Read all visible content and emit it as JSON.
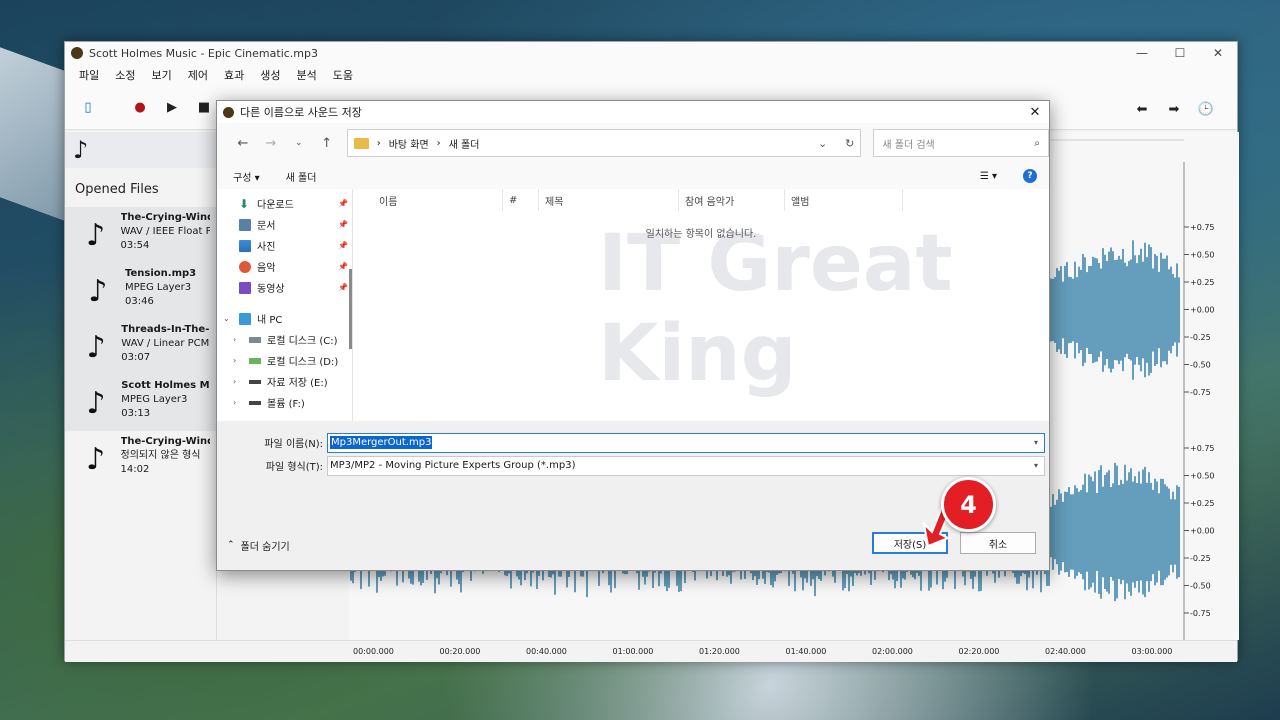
{
  "app": {
    "title": "Scott Holmes Music - Epic Cinematic.mp3",
    "menu": [
      "파일",
      "소정",
      "보기",
      "제어",
      "효과",
      "생성",
      "분석",
      "도움"
    ],
    "opened_files_title": "Opened Files",
    "files": [
      {
        "name": "The-Crying-Wind.",
        "format": "WAV / IEEE Float P",
        "duration": "03:54"
      },
      {
        "name": "Tension.mp3",
        "format": "MPEG Layer3",
        "duration": "03:46"
      },
      {
        "name": "Threads-In-The-S",
        "format": "WAV / Linear PCM",
        "duration": "03:07"
      },
      {
        "name": "Scott Holmes Mu",
        "format": "MPEG Layer3",
        "duration": "03:13"
      },
      {
        "name": "The-Crying-Wind.",
        "format": "정의되지 않은 형식",
        "duration": "14:02"
      }
    ],
    "amp_labels_top": [
      "+0.75",
      "+0.50",
      "+0.25",
      "+0.00",
      "-0.25",
      "-0.50",
      "-0.75"
    ],
    "amp_labels_bottom": [
      "+0.75",
      "+0.50",
      "+0.25",
      "+0.00",
      "-0.25",
      "-0.50",
      "-0.75"
    ],
    "time_ticks": [
      "00:00.000",
      "00:20.000",
      "00:40.000",
      "01:00.000",
      "01:20.000",
      "01:40.000",
      "02:00.000",
      "02:20.000",
      "02:40.000",
      "03:00.000"
    ]
  },
  "dialog": {
    "title": "다른 이름으로 사운드 저장",
    "breadcrumb": [
      "바탕 화면",
      "새 폴더"
    ],
    "search_placeholder": "새 폴더 검색",
    "organize": "구성 ▾",
    "new_folder": "새 폴더",
    "nav_items": [
      {
        "label": "다운로드",
        "icon": "download-icon",
        "pinned": true
      },
      {
        "label": "문서",
        "icon": "document-icon",
        "pinned": true
      },
      {
        "label": "사진",
        "icon": "picture-icon",
        "pinned": true
      },
      {
        "label": "음악",
        "icon": "music-icon",
        "pinned": true
      },
      {
        "label": "동영상",
        "icon": "video-icon",
        "pinned": true
      }
    ],
    "this_pc": "내 PC",
    "drives": [
      "로컬 디스크 (C:)",
      "로컬 디스크 (D:)",
      "자료 저장 (E:)",
      "볼륨 (F:)"
    ],
    "columns": [
      "이름",
      "#",
      "제목",
      "참여 음악가",
      "앨범"
    ],
    "empty_message": "일치하는 항목이 없습니다.",
    "filename_label": "파일 이름(N):",
    "filename_value": "Mp3MergerOut.mp3",
    "filetype_label": "파일 형식(T):",
    "filetype_value": "MP3/MP2 - Moving Picture Experts Group (*.mp3)",
    "hide_folders": "폴더 숨기기",
    "save_label": "저장(S)",
    "cancel_label": "취소"
  },
  "watermark": "IT Great King",
  "step_badge": "4",
  "colors": {
    "accent": "#0b66d0",
    "wave": "#3e87ad",
    "badge": "#e31e24"
  }
}
